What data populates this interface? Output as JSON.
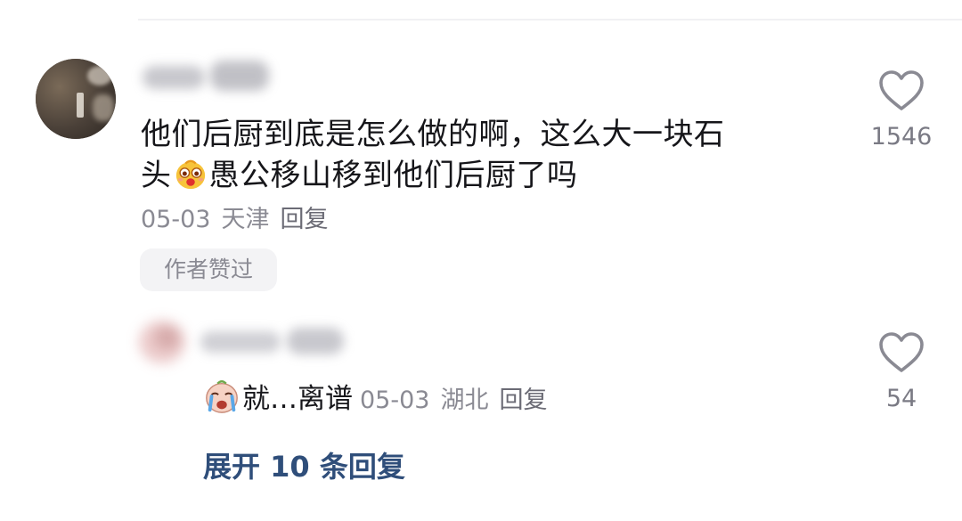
{
  "comment": {
    "text_line1": "他们后厨到底是怎么做的啊，这么大一块石",
    "text_line2_prefix": "头",
    "text_emoji_icon": "shocked-face-emoji-icon",
    "text_line2_suffix": "愚公移山移到他们后厨了吗",
    "date": "05-03",
    "location": "天津",
    "reply_label": "回复",
    "author_liked_label": "作者赞过",
    "like_icon": "heart-outline-icon",
    "like_count": "1546"
  },
  "reply": {
    "emoji_icon": "crying-face-emoji-icon",
    "text": "就…离谱",
    "date": "05-03",
    "location": "湖北",
    "reply_label": "回复",
    "like_icon": "heart-outline-icon",
    "like_count": "54"
  },
  "expand_replies_label": "展开 10 条回复",
  "colors": {
    "text_primary": "#16161a",
    "text_secondary": "#8a8a93",
    "link_accent": "#2f4e7a",
    "chip_background": "#f3f3f5",
    "icon_stroke": "#8a8a93"
  }
}
